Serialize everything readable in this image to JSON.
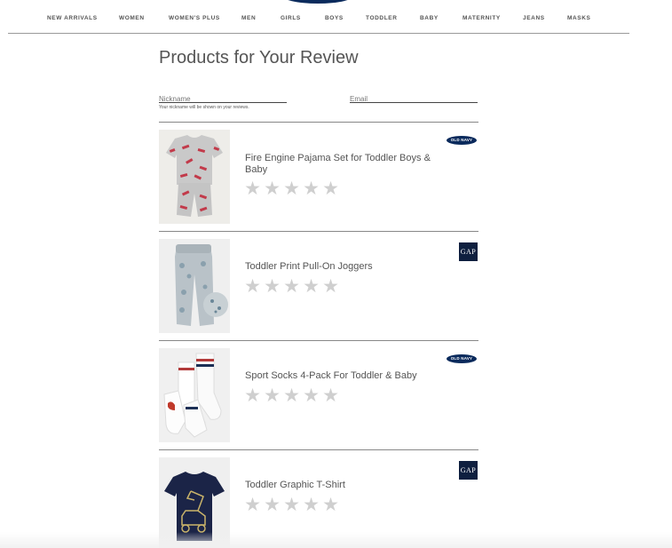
{
  "nav": {
    "items": [
      "NEW ARRIVALS",
      "WOMEN",
      "WOMEN'S PLUS",
      "MEN",
      "GIRLS",
      "BOYS",
      "TODDLER",
      "BABY",
      "MATERNITY",
      "JEANS",
      "MASKS"
    ]
  },
  "page": {
    "title": "Products for Your Review"
  },
  "form": {
    "nickname_placeholder": "Nickname",
    "email_placeholder": "Email",
    "nickname_hint": "Your nickname will be shown on your reviews."
  },
  "products": [
    {
      "name": "Fire Engine Pajama Set for Toddler Boys & Baby",
      "brand": "OLD NAVY",
      "brand_type": "oldnavy",
      "rating": 0
    },
    {
      "name": "Toddler Print Pull-On Joggers",
      "brand": "GAP",
      "brand_type": "gap",
      "rating": 0
    },
    {
      "name": "Sport Socks 4-Pack For Toddler & Baby",
      "brand": "OLD NAVY",
      "brand_type": "oldnavy",
      "rating": 0
    },
    {
      "name": "Toddler Graphic T-Shirt",
      "brand": "GAP",
      "brand_type": "gap",
      "rating": 0
    }
  ],
  "colors": {
    "oldnavy_blue": "#0a2a5c",
    "gap_navy": "#0e1f3f",
    "star_empty": "#cfcfcf"
  }
}
